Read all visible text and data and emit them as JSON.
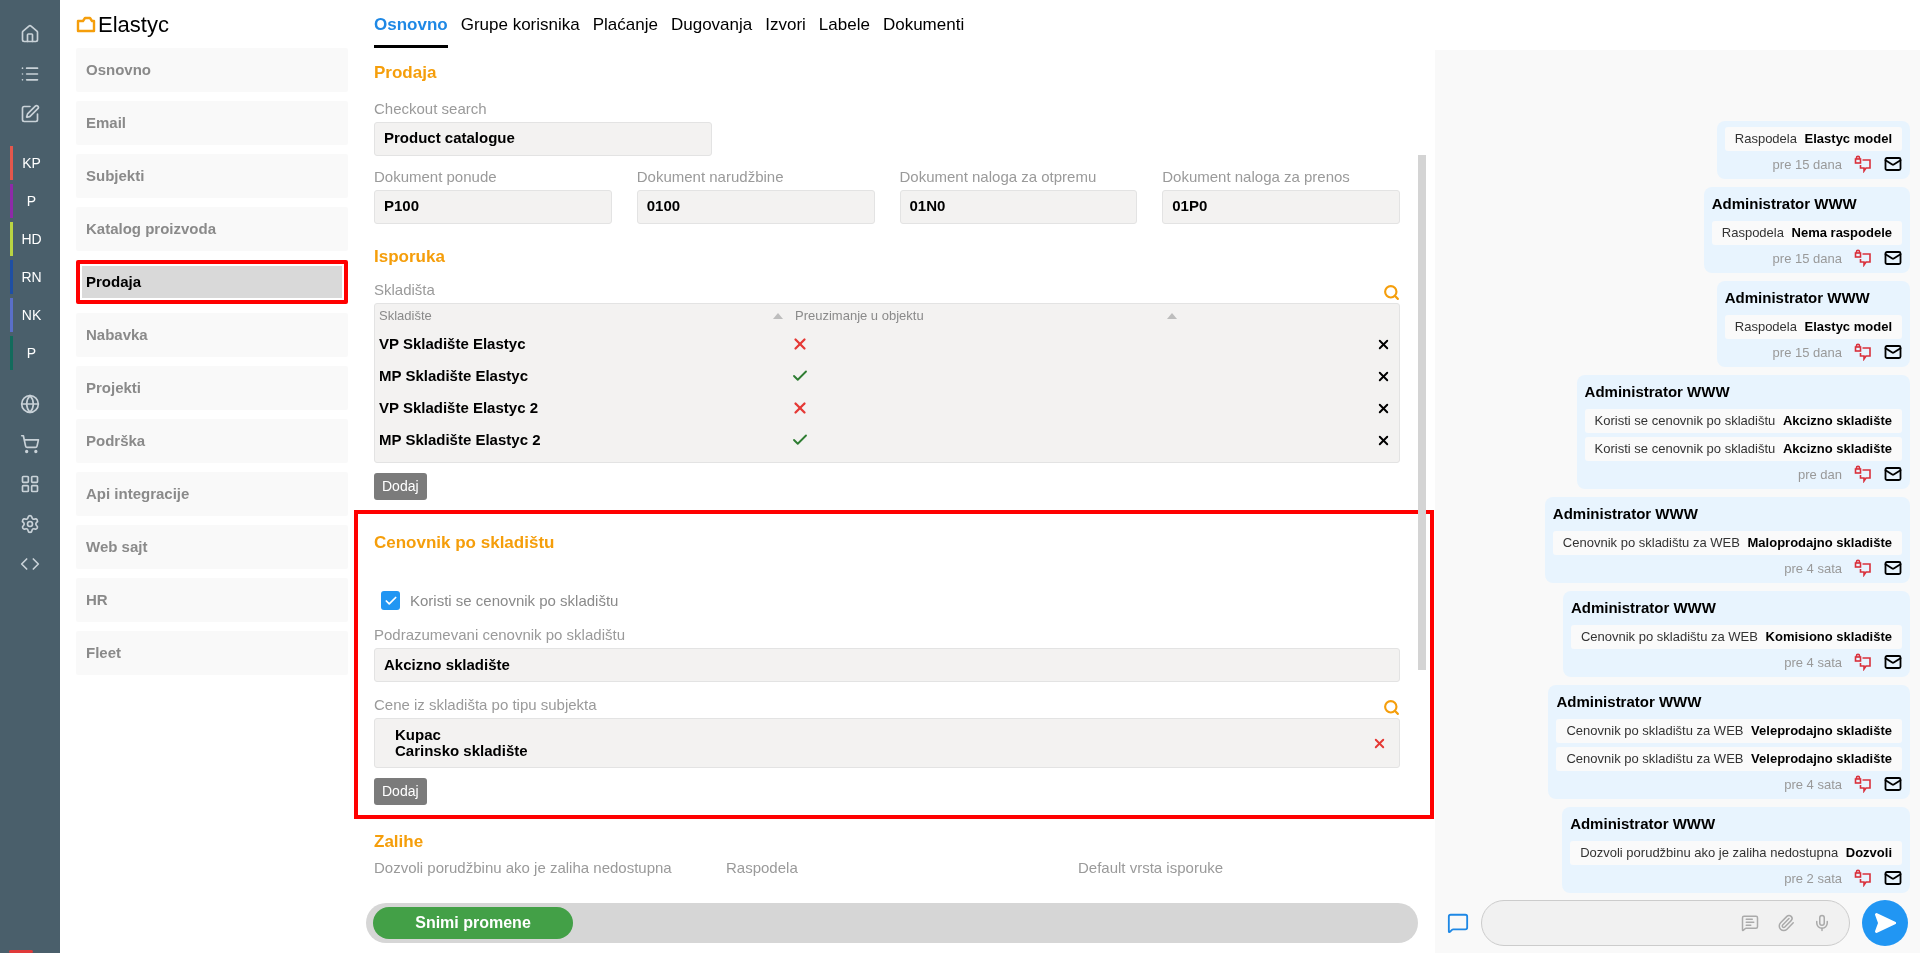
{
  "rail": {
    "modules": [
      {
        "label": "KP",
        "color": "#e4574c"
      },
      {
        "label": "P",
        "color": "#8e2aa8"
      },
      {
        "label": "HD",
        "color": "#b9d443"
      },
      {
        "label": "RN",
        "color": "#1f4fa3"
      },
      {
        "label": "NK",
        "color": "#5a6fc8"
      },
      {
        "label": "P",
        "color": "#136b5c"
      }
    ]
  },
  "logo": {
    "text": "Elastyc"
  },
  "sidebar": {
    "items": [
      {
        "label": "Osnovno",
        "selected": false,
        "highlighted": false
      },
      {
        "label": "Email",
        "selected": false,
        "highlighted": false
      },
      {
        "label": "Subjekti",
        "selected": false,
        "highlighted": false
      },
      {
        "label": "Katalog proizvoda",
        "selected": false,
        "highlighted": false
      },
      {
        "label": "Prodaja",
        "selected": true,
        "highlighted": true
      },
      {
        "label": "Nabavka",
        "selected": false,
        "highlighted": false
      },
      {
        "label": "Projekti",
        "selected": false,
        "highlighted": false
      },
      {
        "label": "Podrška",
        "selected": false,
        "highlighted": false
      },
      {
        "label": "Api integracije",
        "selected": false,
        "highlighted": false
      },
      {
        "label": "Web sajt",
        "selected": false,
        "highlighted": false
      },
      {
        "label": "HR",
        "selected": false,
        "highlighted": false
      },
      {
        "label": "Fleet",
        "selected": false,
        "highlighted": false
      }
    ]
  },
  "tabs": [
    {
      "label": "Osnovno",
      "selected": true
    },
    {
      "label": "Grupe korisnika",
      "selected": false
    },
    {
      "label": "Plaćanje",
      "selected": false
    },
    {
      "label": "Dugovanja",
      "selected": false
    },
    {
      "label": "Izvori",
      "selected": false
    },
    {
      "label": "Labele",
      "selected": false
    },
    {
      "label": "Dokumenti",
      "selected": false
    }
  ],
  "prodaja": {
    "title": "Prodaja",
    "checkout": {
      "label": "Checkout search",
      "value": "Product catalogue"
    },
    "documents": [
      {
        "label": "Dokument ponude",
        "value": "P100"
      },
      {
        "label": "Dokument narudžbine",
        "value": "0100"
      },
      {
        "label": "Dokument naloga za otpremu",
        "value": "01N0"
      },
      {
        "label": "Dokument naloga za prenos",
        "value": "01P0"
      }
    ]
  },
  "isporuka": {
    "title": "Isporuka",
    "label": "Skladišta",
    "columns": [
      "Skladište",
      "Preuzimanje u objektu"
    ],
    "rows": [
      {
        "name": "VP Skladište Elastyc",
        "pickup": false
      },
      {
        "name": "MP Skladište Elastyc",
        "pickup": true
      },
      {
        "name": "VP Skladište Elastyc 2",
        "pickup": false
      },
      {
        "name": "MP Skladište Elastyc 2",
        "pickup": true
      }
    ],
    "add_button": "Dodaj"
  },
  "cenovnik": {
    "title": "Cenovnik po skladištu",
    "highlighted": true,
    "checkbox": {
      "label": "Koristi se cenovnik po skladištu",
      "checked": true
    },
    "default_pricelist": {
      "label": "Podrazumevani cenovnik po skladištu",
      "value": "Akcizno skladište"
    },
    "by_type": {
      "label": "Cene iz skladišta po tipu subjekta",
      "rows": [
        {
          "type": "Kupac",
          "warehouse": "Carinsko skladište"
        }
      ]
    },
    "add_button": "Dodaj"
  },
  "zalihe": {
    "title": "Zalihe",
    "labels": [
      "Dozvoli porudžbinu ako je zaliha nedostupna",
      "Raspodela",
      "Default vrsta isporuke"
    ]
  },
  "save_button": "Snimi promene",
  "chat": {
    "messages": [
      {
        "changes": [
          {
            "field": "Raspodela",
            "value": "Elastyc model"
          }
        ],
        "time": "pre 15 dana"
      },
      {
        "author": "Administrator WWW",
        "changes": [
          {
            "field": "Raspodela",
            "value": "Nema raspodele"
          }
        ],
        "time": "pre 15 dana"
      },
      {
        "author": "Administrator WWW",
        "changes": [
          {
            "field": "Raspodela",
            "value": "Elastyc model"
          }
        ],
        "time": "pre 15 dana"
      },
      {
        "author": "Administrator WWW",
        "changes": [
          {
            "field": "Koristi se cenovnik po skladištu",
            "value": "Akcizno skladište"
          },
          {
            "field": "Koristi se cenovnik po skladištu",
            "value": "Akcizno skladište"
          }
        ],
        "time": "pre dan"
      },
      {
        "author": "Administrator WWW",
        "changes": [
          {
            "field": "Cenovnik po skladištu za WEB",
            "value": "Maloprodajno skladište"
          }
        ],
        "time": "pre 4 sata"
      },
      {
        "author": "Administrator WWW",
        "changes": [
          {
            "field": "Cenovnik po skladištu za WEB",
            "value": "Komisiono skladište"
          }
        ],
        "time": "pre 4 sata"
      },
      {
        "author": "Administrator WWW",
        "changes": [
          {
            "field": "Cenovnik po skladištu za WEB",
            "value": "Veleprodajno skladište"
          },
          {
            "field": "Cenovnik po skladištu za WEB",
            "value": "Veleprodajno skladište"
          }
        ],
        "time": "pre 4 sata"
      },
      {
        "author": "Administrator WWW",
        "changes": [
          {
            "field": "Dozvoli porudžbinu ako je zaliha nedostupna",
            "value": "Dozvoli"
          }
        ],
        "time": "pre 2 sata"
      }
    ]
  }
}
